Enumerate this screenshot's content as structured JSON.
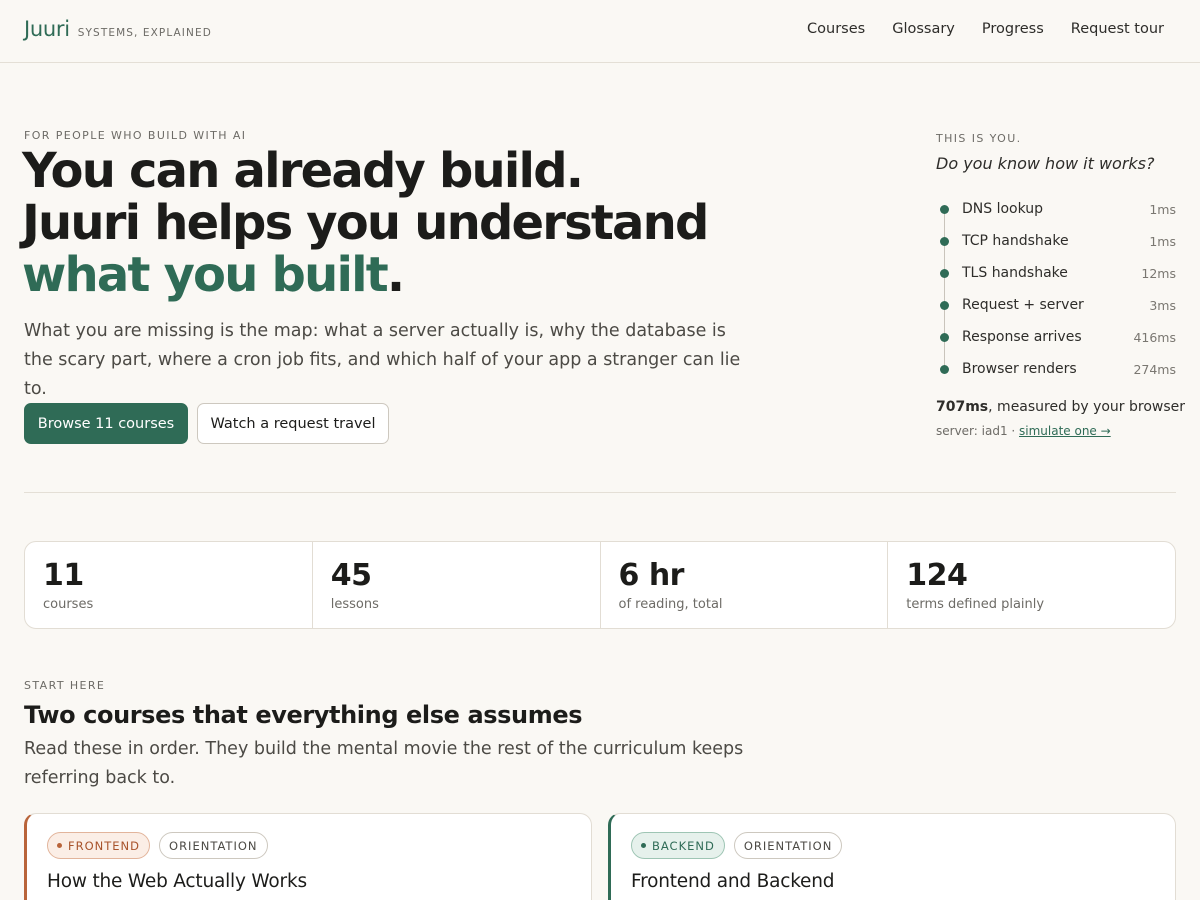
{
  "header": {
    "brand": "Juuri",
    "tagline": "SYSTEMS, EXPLAINED",
    "nav": [
      "Courses",
      "Glossary",
      "Progress",
      "Request tour"
    ]
  },
  "hero": {
    "eyebrow": "FOR PEOPLE WHO BUILD WITH AI",
    "title_line1": "You can already build.",
    "title_line2": "Juuri helps you understand",
    "title_accent": "what you built",
    "title_period": ".",
    "subtitle": "What you are missing is the map: what a server actually is, why the database is the scary part, where a cron job fits, and which half of your app a stranger can lie to.",
    "primary_button": "Browse 11 courses",
    "secondary_button": "Watch a request travel"
  },
  "panel": {
    "eyebrow": "THIS IS YOU.",
    "question": "Do you know how it works?",
    "steps": [
      {
        "label": "DNS lookup",
        "time": "1ms"
      },
      {
        "label": "TCP handshake",
        "time": "1ms"
      },
      {
        "label": "TLS handshake",
        "time": "12ms"
      },
      {
        "label": "Request + server",
        "time": "3ms"
      },
      {
        "label": "Response arrives",
        "time": "416ms"
      },
      {
        "label": "Browser renders",
        "time": "274ms"
      }
    ],
    "total": "707ms",
    "total_suffix": ", measured by your browser",
    "server_prefix": "server: iad1 · ",
    "simulate_link": "simulate one →"
  },
  "stats": [
    {
      "value": "11",
      "label": "courses"
    },
    {
      "value": "45",
      "label": "lessons"
    },
    {
      "value": "6 hr",
      "label": "of reading, total"
    },
    {
      "value": "124",
      "label": "terms defined plainly"
    }
  ],
  "start": {
    "eyebrow": "START HERE",
    "title": "Two courses that everything else assumes",
    "subtitle": "Read these in order. They build the mental movie the rest of the curriculum keeps referring back to."
  },
  "courses": [
    {
      "tag_primary": "FRONTEND",
      "tag_secondary": "ORIENTATION",
      "title": "How the Web Actually Works"
    },
    {
      "tag_primary": "BACKEND",
      "tag_secondary": "ORIENTATION",
      "title": "Frontend and Backend"
    }
  ],
  "colors": {
    "accent": "#2f6b56",
    "frontend": "#b9643a",
    "background": "#faf8f4"
  }
}
